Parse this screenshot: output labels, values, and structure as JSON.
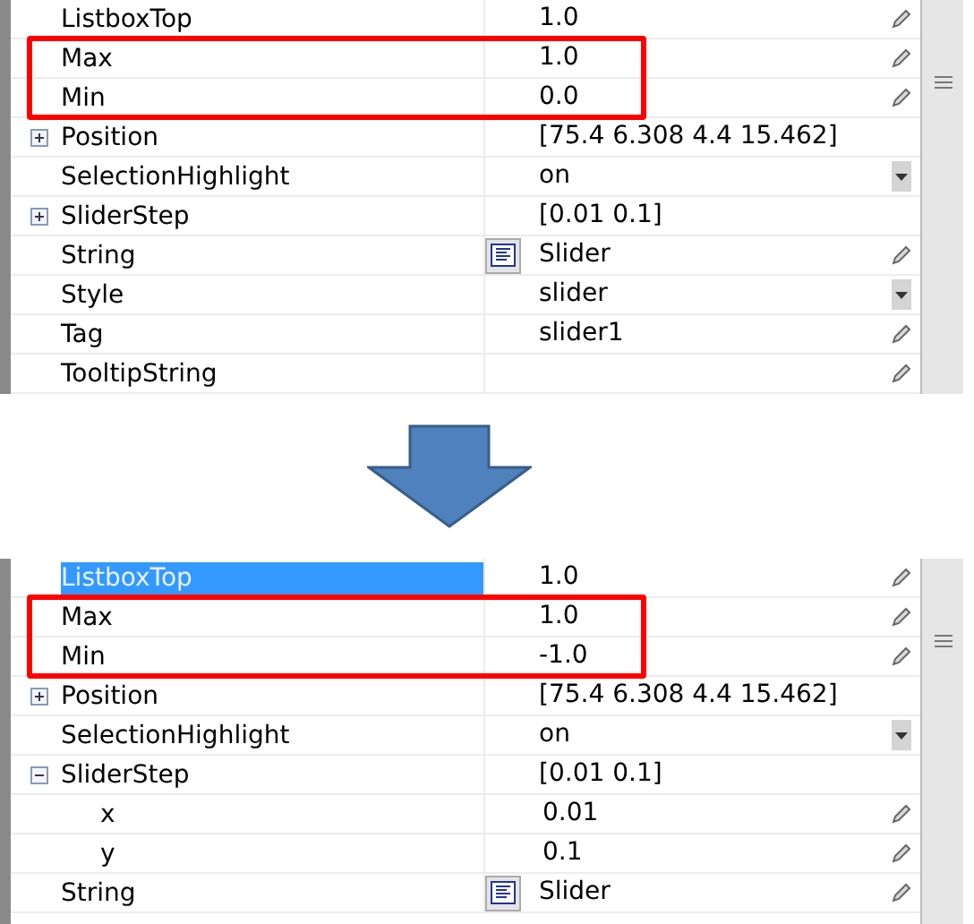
{
  "panels": [
    {
      "rows": [
        {
          "name": "ListboxTop",
          "value": "1.0",
          "kind": "edit",
          "selected": false,
          "highlighted": false
        },
        {
          "name": "Max",
          "value": "1.0",
          "kind": "edit",
          "selected": false,
          "highlighted": true
        },
        {
          "name": "Min",
          "value": "0.0",
          "kind": "edit",
          "selected": false,
          "highlighted": true
        },
        {
          "name": "Position",
          "value": "[75.4  6.308  4.4  15.462]",
          "kind": "text",
          "expanded": false,
          "selected": false,
          "highlighted": false
        },
        {
          "name": "SelectionHighlight",
          "value": "on",
          "kind": "dropdown",
          "selected": false,
          "highlighted": false
        },
        {
          "name": "SliderStep",
          "value": "[0.01  0.1]",
          "kind": "text",
          "expanded": false,
          "selected": false,
          "highlighted": false
        },
        {
          "name": "String",
          "value": "Slider",
          "kind": "string",
          "selected": false,
          "highlighted": false
        },
        {
          "name": "Style",
          "value": "slider",
          "kind": "dropdown",
          "selected": false,
          "highlighted": false
        },
        {
          "name": "Tag",
          "value": "slider1",
          "kind": "edit",
          "selected": false,
          "highlighted": false
        },
        {
          "name": "TooltipString",
          "kind": "edit",
          "selected": false,
          "highlighted": false
        }
      ]
    },
    {
      "rows": [
        {
          "name": "ListboxTop",
          "value": "1.0",
          "kind": "edit",
          "selected": true,
          "highlighted": false
        },
        {
          "name": "Max",
          "value": "1.0",
          "kind": "edit",
          "selected": false,
          "highlighted": true
        },
        {
          "name": "Min",
          "value": "-1.0",
          "kind": "edit",
          "selected": false,
          "highlighted": true
        },
        {
          "name": "Position",
          "value": "[75.4  6.308  4.4  15.462]",
          "kind": "text",
          "expanded": false,
          "selected": false,
          "highlighted": false
        },
        {
          "name": "SelectionHighlight",
          "value": "on",
          "kind": "dropdown",
          "selected": false,
          "highlighted": false
        },
        {
          "name": "SliderStep",
          "value": "[0.01  0.1]",
          "kind": "text",
          "expanded": true,
          "selected": false,
          "highlighted": false,
          "children": [
            {
              "name": "x",
              "value": "0.01",
              "kind": "edit",
              "selected": false,
              "highlighted": false
            },
            {
              "name": "y",
              "value": "0.1",
              "kind": "edit",
              "selected": false,
              "highlighted": false
            }
          ]
        },
        {
          "name": "String",
          "value": "Slider",
          "kind": "string",
          "selected": false,
          "highlighted": false
        }
      ]
    }
  ]
}
